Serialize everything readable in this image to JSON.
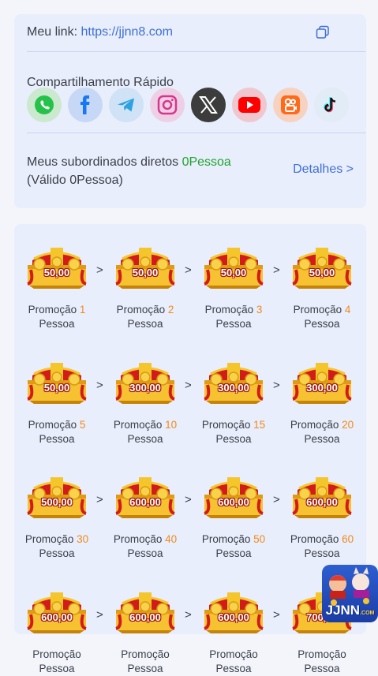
{
  "link": {
    "label": "Meu link:",
    "url": "https://jjnn8.com"
  },
  "share": {
    "title": "Compartilhamento Rápido",
    "icons": [
      "whatsapp-icon",
      "facebook-icon",
      "telegram-icon",
      "instagram-icon",
      "x-icon",
      "youtube-icon",
      "kwai-icon",
      "tiktok-icon"
    ]
  },
  "subordinates": {
    "prefix": "Meus subordinados diretos",
    "count": "0Pessoa",
    "valid": "(Válido 0Pessoa)",
    "details": "Detalhes >"
  },
  "rewards": {
    "caption_prefix": "Promoção",
    "caption_suffix": "Pessoa",
    "arrow": ">",
    "items": [
      {
        "amount": "50,00",
        "count": "1"
      },
      {
        "amount": "50,00",
        "count": "2"
      },
      {
        "amount": "50,00",
        "count": "3"
      },
      {
        "amount": "50,00",
        "count": "4"
      },
      {
        "amount": "50,00",
        "count": "5"
      },
      {
        "amount": "300,00",
        "count": "10"
      },
      {
        "amount": "300,00",
        "count": "15"
      },
      {
        "amount": "300,00",
        "count": "20"
      },
      {
        "amount": "500,00",
        "count": "30"
      },
      {
        "amount": "600,00",
        "count": "40"
      },
      {
        "amount": "600,00",
        "count": "50"
      },
      {
        "amount": "600,00",
        "count": "60"
      },
      {
        "amount": "600,00",
        "count": ""
      },
      {
        "amount": "600,00",
        "count": ""
      },
      {
        "amount": "600,00",
        "count": ""
      },
      {
        "amount": "700,00",
        "count": ""
      }
    ]
  },
  "logo": {
    "text": "JJNN",
    "suffix": ".COM"
  },
  "colors": {
    "accent": "#3f6fd8",
    "green": "#22a330",
    "orange": "#f08a1c",
    "card": "#e8eefb"
  }
}
